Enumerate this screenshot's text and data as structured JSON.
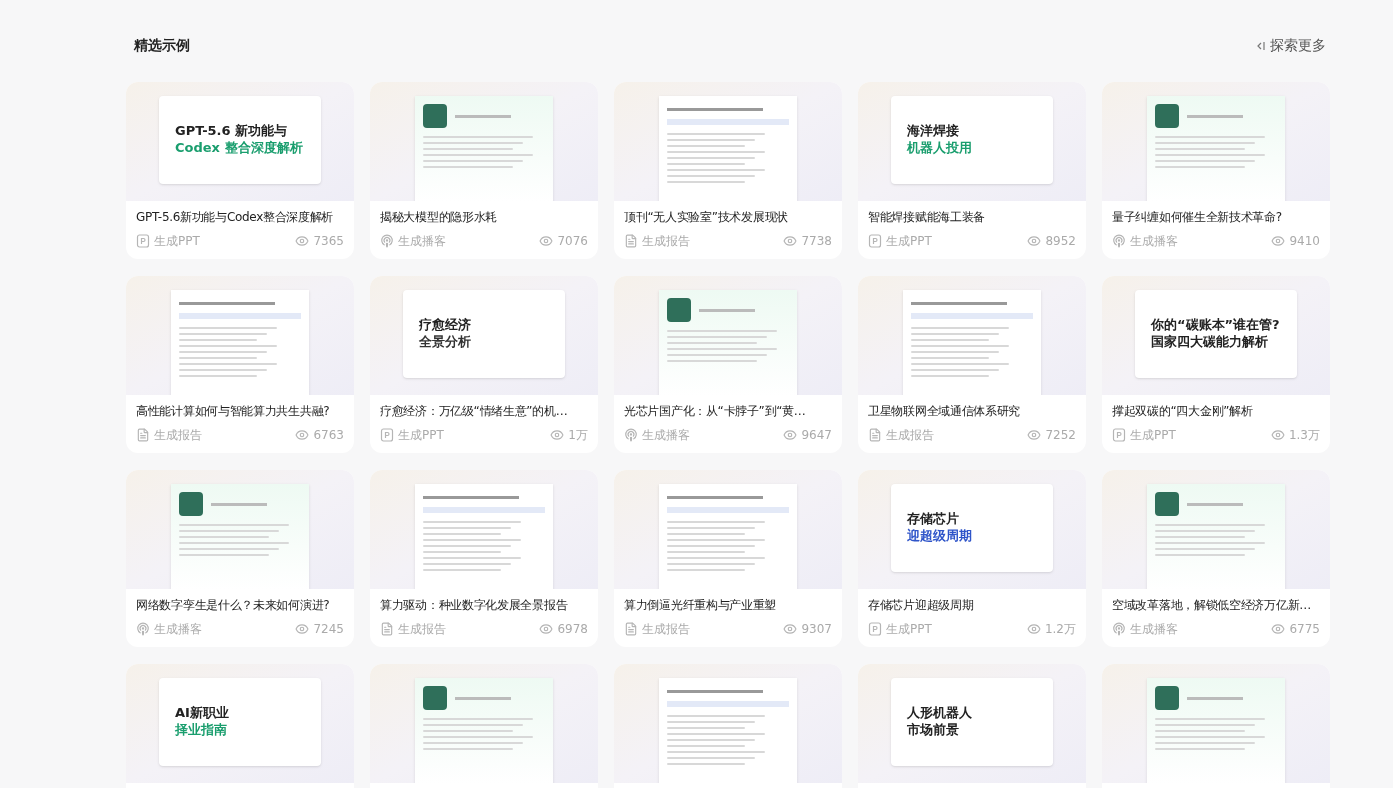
{
  "section": {
    "title": "精选示例",
    "more_link": "探索更多"
  },
  "cards": [
    {
      "title": "GPT-5.6新功能与Codex整合深度解析",
      "kind": "ppt",
      "type_label": "生成PPT",
      "views": "7365",
      "preview": {
        "kind": "slide",
        "headline": [
          "GPT-5.6 新功能与",
          "Codex 整合深度解析"
        ],
        "color": "#1a9e6e"
      }
    },
    {
      "title": "揭秘大模型的隐形水耗",
      "kind": "podcast",
      "type_label": "生成播客",
      "views": "7076",
      "preview": {
        "kind": "podcast"
      }
    },
    {
      "title": "顶刊“无人实验室”技术发展现状",
      "kind": "report",
      "type_label": "生成报告",
      "views": "7738",
      "preview": {
        "kind": "report"
      }
    },
    {
      "title": "智能焊接赋能海工装备",
      "kind": "ppt",
      "type_label": "生成PPT",
      "views": "8952",
      "preview": {
        "kind": "slide",
        "headline": [
          "海洋焊接",
          "机器人投用"
        ],
        "color": "#1a9e6e"
      }
    },
    {
      "title": "量子纠缠如何催生全新技术革命?",
      "kind": "podcast",
      "type_label": "生成播客",
      "views": "9410",
      "preview": {
        "kind": "podcast"
      }
    },
    {
      "title": "高性能计算如何与智能算力共生共融?",
      "kind": "report",
      "type_label": "生成报告",
      "views": "6763",
      "preview": {
        "kind": "report"
      }
    },
    {
      "title": "疗愈经济：万亿级“情绪生意”的机…",
      "kind": "ppt",
      "type_label": "生成PPT",
      "views": "1万",
      "preview": {
        "kind": "slide",
        "headline": [
          "疗愈经济",
          "全景分析"
        ],
        "color": "#333333"
      }
    },
    {
      "title": "光芯片国产化：从“卡脖子”到“黄…",
      "kind": "podcast",
      "type_label": "生成播客",
      "views": "9647",
      "preview": {
        "kind": "podcast"
      }
    },
    {
      "title": "卫星物联网全域通信体系研究",
      "kind": "report",
      "type_label": "生成报告",
      "views": "7252",
      "preview": {
        "kind": "report"
      }
    },
    {
      "title": "撑起双碳的“四大金刚”解析",
      "kind": "ppt",
      "type_label": "生成PPT",
      "views": "1.3万",
      "preview": {
        "kind": "slide",
        "headline": [
          "你的“碳账本”谁在管?",
          "国家四大碳能力解析"
        ],
        "color": "#222222"
      }
    },
    {
      "title": "网络数字孪生是什么？未来如何演进?",
      "kind": "podcast",
      "type_label": "生成播客",
      "views": "7245",
      "preview": {
        "kind": "podcast"
      }
    },
    {
      "title": "算力驱动：种业数字化发展全景报告",
      "kind": "report",
      "type_label": "生成报告",
      "views": "6978",
      "preview": {
        "kind": "report"
      }
    },
    {
      "title": "算力倒逼光纤重构与产业重塑",
      "kind": "report",
      "type_label": "生成报告",
      "views": "9307",
      "preview": {
        "kind": "report"
      }
    },
    {
      "title": "存储芯片迎超级周期",
      "kind": "ppt",
      "type_label": "生成PPT",
      "views": "1.2万",
      "preview": {
        "kind": "slide",
        "headline": [
          "存储芯片",
          "迎超级周期"
        ],
        "color": "#2f55c9"
      }
    },
    {
      "title": "空域改革落地，解锁低空经济万亿新…",
      "kind": "podcast",
      "type_label": "生成播客",
      "views": "6775",
      "preview": {
        "kind": "podcast"
      }
    },
    {
      "preview": {
        "kind": "slide",
        "headline": [
          "AI新职业",
          "择业指南"
        ],
        "color": "#1a9e6e"
      }
    },
    {
      "preview": {
        "kind": "podcast"
      }
    },
    {
      "preview": {
        "kind": "report"
      }
    },
    {
      "preview": {
        "kind": "slide",
        "headline": [
          "人形机器人",
          "市场前景"
        ],
        "color": "#222222"
      }
    },
    {
      "preview": {
        "kind": "podcast"
      }
    }
  ]
}
